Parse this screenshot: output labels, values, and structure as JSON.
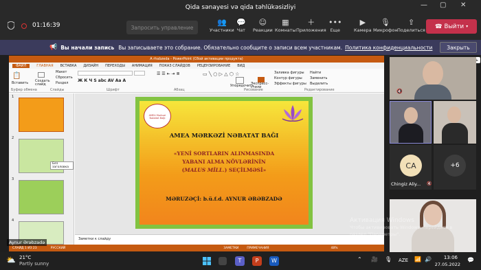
{
  "window": {
    "title": "Qida sənayesi və qida təhlükəsizliyi",
    "timer": "01:16:39",
    "minimize": "—",
    "maximize": "▢",
    "close": "✕"
  },
  "toolbar": {
    "takeover": "Запросить управление",
    "participants": "Участники",
    "chat": "Чат",
    "reactions": "Реакции",
    "rooms": "Комнаты",
    "apps": "Приложения",
    "more": "Еще",
    "camera": "Камера",
    "mic": "Микрофон",
    "share": "Поделиться",
    "leave": "Выйти"
  },
  "banner": {
    "bold": "Вы начали запись",
    "text": "Вы записываете это собрание. Обязательно сообщите о записи всем участникам.",
    "link": "Политика конфиденциальности",
    "close": "Закрыть",
    "tooltip": "Закрыть"
  },
  "ppt": {
    "title": "A rhabzeda - PowerPoint (Сбой активации продукта)",
    "tabs": [
      "ФАЙЛ",
      "ГЛАВНАЯ",
      "ВСТАВКА",
      "ДИЗАЙН",
      "ПЕРЕХОДЫ",
      "АНИМАЦИЯ",
      "ПОКАЗ СЛАЙДОВ",
      "РЕЦЕНЗИРОВАНИЕ",
      "ВИД"
    ],
    "ribbon": {
      "paste": "Вставить",
      "create": "Создать слайд",
      "layout": "Макет",
      "reset": "Сбросить",
      "section": "Раздел",
      "group_clipboard": "Буфер обмена",
      "group_slides": "Слайды",
      "group_font": "Шрифт",
      "group_paragraph": "Абзац",
      "arrange": "Упорядочить",
      "quick_styles": "Экспресс-стили",
      "group_drawing": "Рисование",
      "shape_fill": "Заливка фигуры",
      "shape_outline": "Контур фигуры",
      "shape_effects": "Эффекты фигуры",
      "find": "Найти",
      "replace": "Заменить",
      "select": "Выделить",
      "group_editing": "Редактирование"
    },
    "thumb_numbers": [
      "1",
      "2",
      "3",
      "4"
    ],
    "thumb_tooltip": "Без заголовка",
    "slide": {
      "seal_text": "AMEA Mərkəzi Nəbatat Bağı",
      "title": "AMEA MƏRKƏZİ NƏBATAT BAĞI",
      "topic_1": "«YENİ SORTLARIN ALINMASINDA",
      "topic_2": "YABANI ALMA NÖVLƏRİNİN",
      "topic_3a": "(",
      "topic_3b": "MALUS MİLL.",
      "topic_3c": ") SEÇİLMƏSİ»",
      "speaker": "MƏRUZƏÇİ: b.ü.f.d. AYNUR ƏRƏBZADƏ"
    },
    "notes": "Заметки к слайду",
    "status": {
      "slide": "СЛАЙД 1 ИЗ 23",
      "lang": "РУССКИЙ",
      "notes": "ЗАМЕТКИ",
      "comments": "ПРИМЕЧАНИЯ",
      "zoom": "48%"
    }
  },
  "presenter_name": "Aynur Ərəbzadə",
  "participants": {
    "initials": "CA",
    "name": "Chingiz Aliy...",
    "more": "+6"
  },
  "watermark": {
    "line1": "Активация Windows",
    "line2": "Чтобы активировать Windows, перейдите в",
    "line3": "раздел \"Параметры\"."
  },
  "taskbar": {
    "temp": "21°C",
    "weather": "Partly sunny",
    "lang": "AZE",
    "time": "13:06",
    "date": "27.05.2022"
  }
}
